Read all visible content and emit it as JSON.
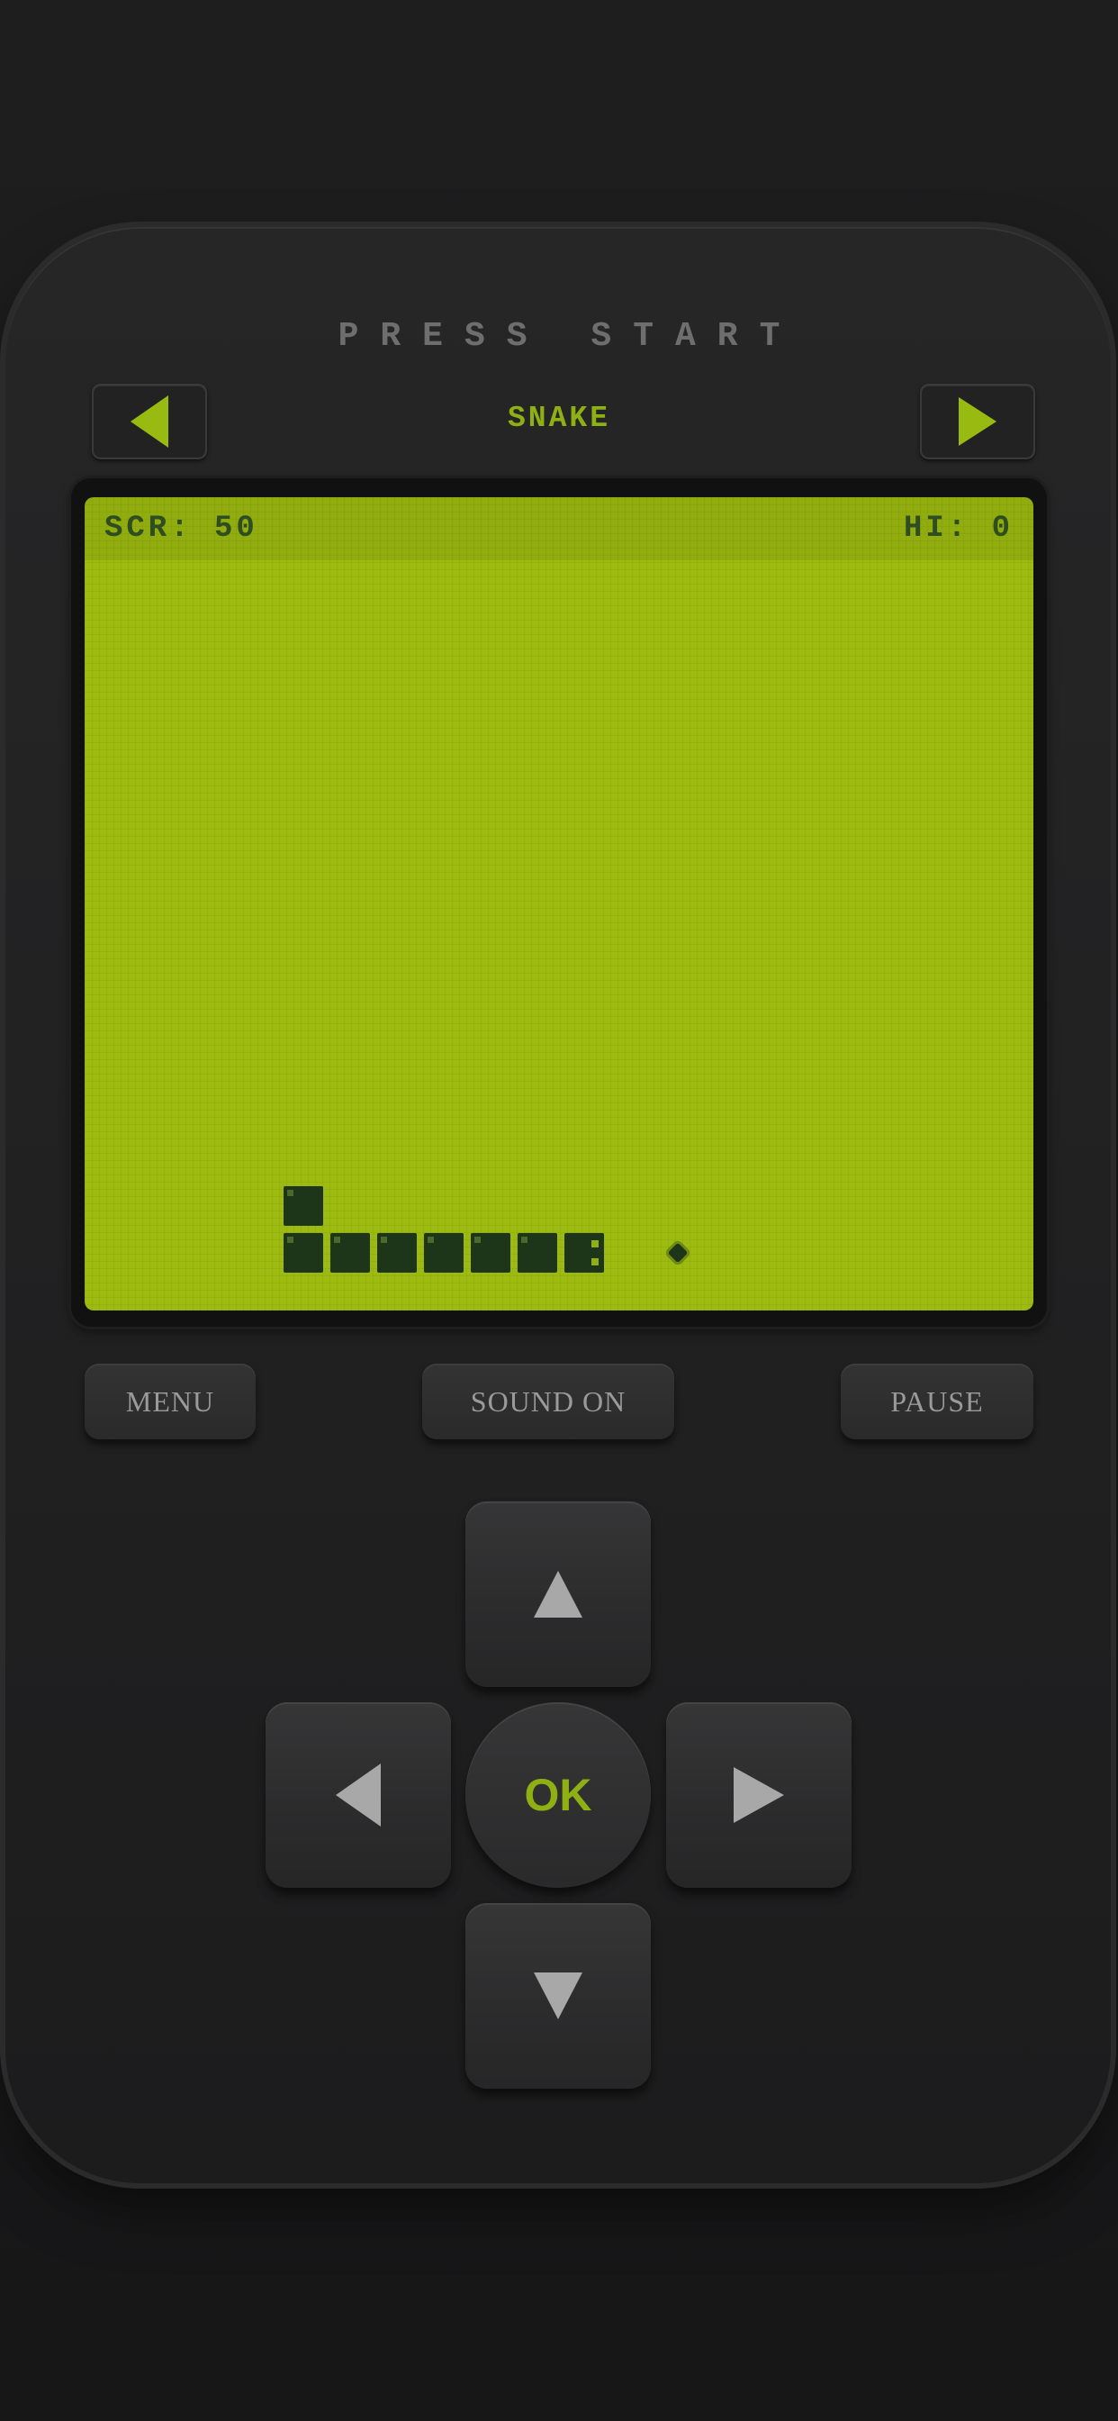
{
  "header": {
    "press_start": "PRESS START",
    "game_title": "SNAKE"
  },
  "nav": {
    "prev_icon": "triangle-left-icon",
    "next_icon": "triangle-right-icon"
  },
  "hud": {
    "score_text": "SCR: 50",
    "hi_text": "HI: 0"
  },
  "game": {
    "grid_unit": "cell",
    "snake": [
      [
        9,
        15
      ],
      [
        8,
        15
      ],
      [
        7,
        15
      ],
      [
        6,
        15
      ],
      [
        5,
        15
      ],
      [
        4,
        15
      ],
      [
        3,
        15
      ],
      [
        3,
        14
      ]
    ],
    "food": [
      11,
      15
    ]
  },
  "controls": {
    "menu_label": "MENU",
    "sound_label": "SOUND ON",
    "pause_label": "PAUSE"
  },
  "dpad": {
    "ok_label": "OK",
    "up_icon": "arrow-up-icon",
    "down_icon": "arrow-down-icon",
    "left_icon": "arrow-left-icon",
    "right_icon": "arrow-right-icon"
  },
  "colors": {
    "accent": "#99bb11",
    "lcd": "#9cba10",
    "pixel": "#1d3518",
    "text_dim": "#6e6e6e"
  }
}
